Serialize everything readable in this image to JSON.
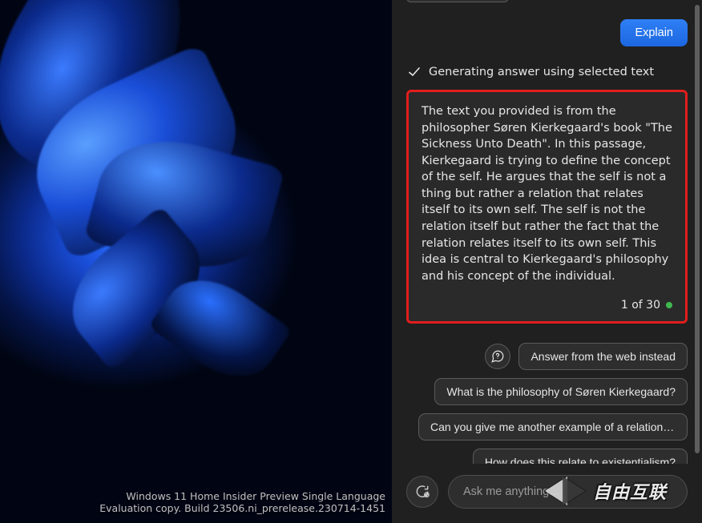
{
  "desktop": {
    "watermark_line1": "Windows 11 Home Insider Preview Single Language",
    "watermark_line2": "Evaluation copy. Build 23506.ni_prerelease.230714-1451"
  },
  "panel": {
    "explain_label": "Explain",
    "status_text": "Generating answer using selected text",
    "answer_text": "The text you provided is from the philosopher Søren Kierkegaard's book \"The Sickness Unto Death\". In this passage, Kierkegaard is trying to define the concept of the self. He argues that the self is not a thing but rather a relation that relates itself to its own self. The self is not the relation itself but rather the fact that the relation relates itself to its own self. This idea is central to Kierkegaard's philosophy and his concept of the individual.",
    "counter_label": "1 of 30",
    "suggestions": [
      "Answer from the web instead",
      "What is the philosophy of Søren Kierkegaard?",
      "Can you give me another example of a relation t...",
      "How does this relate to existentialism?"
    ],
    "input_placeholder": "Ask me anything..."
  },
  "overlay": {
    "brand_text": "自由互联"
  },
  "colors": {
    "accent": "#1f6feb",
    "highlight_border": "#e11d1d",
    "status_dot": "#3fb84f"
  }
}
